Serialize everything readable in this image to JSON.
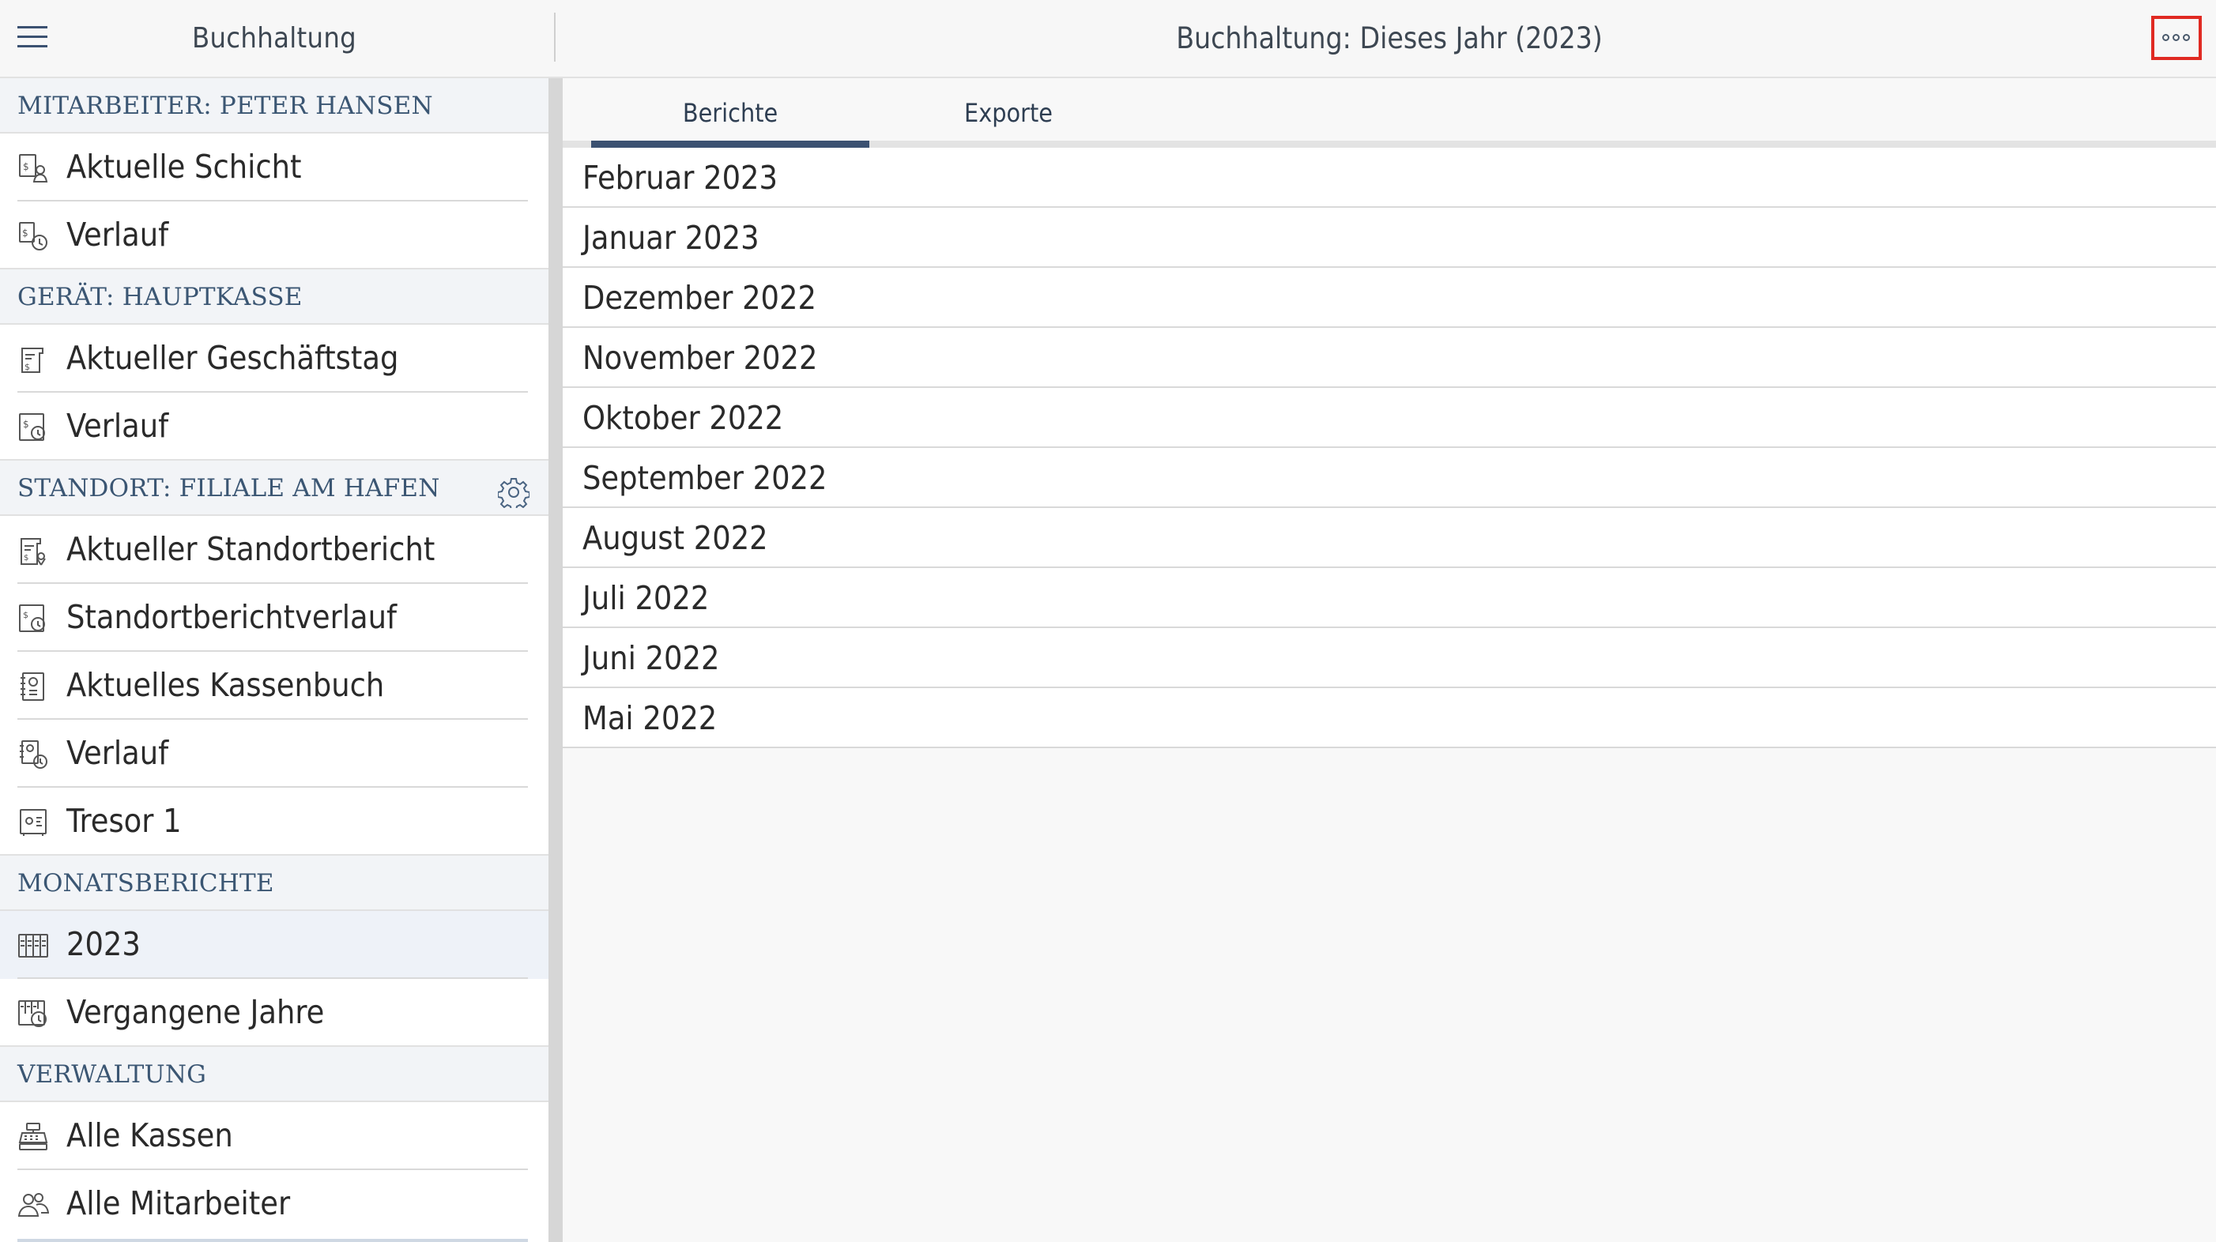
{
  "sidebar": {
    "title": "Buchhaltung",
    "sections": {
      "employee": {
        "header": "MITARBEITER: PETER HANSEN",
        "items": [
          "Aktuelle Schicht",
          "Verlauf"
        ]
      },
      "device": {
        "header": "GERÄT: HAUPTKASSE",
        "items": [
          "Aktueller Geschäftstag",
          "Verlauf"
        ]
      },
      "location": {
        "header": "STANDORT: FILIALE AM HAFEN",
        "items": [
          "Aktueller Standortbericht",
          "Standortberichtverlauf",
          "Aktuelles Kassenbuch",
          "Verlauf",
          "Tresor 1"
        ]
      },
      "monthly": {
        "header": "MONATSBERICHTE",
        "items": [
          "2023",
          "Vergangene Jahre"
        ]
      },
      "admin": {
        "header": "VERWALTUNG",
        "items": [
          "Alle Kassen",
          "Alle Mitarbeiter"
        ]
      }
    }
  },
  "main": {
    "title": "Buchhaltung: Dieses Jahr (2023)",
    "tabs": [
      "Berichte",
      "Exporte"
    ],
    "active_tab": "Berichte",
    "reports": [
      "Februar 2023",
      "Januar 2023",
      "Dezember 2022",
      "November 2022",
      "Oktober 2022",
      "September 2022",
      "August 2022",
      "Juli 2022",
      "Juni 2022",
      "Mai 2022"
    ]
  },
  "colors": {
    "accent": "#3b5171",
    "section_text": "#3b5673",
    "highlight_border": "#e02a22",
    "selected_row": "#eef2f8"
  },
  "icons": {
    "menu": "hamburger-menu-icon",
    "more": "more-options-icon",
    "settings": "gear-icon"
  }
}
